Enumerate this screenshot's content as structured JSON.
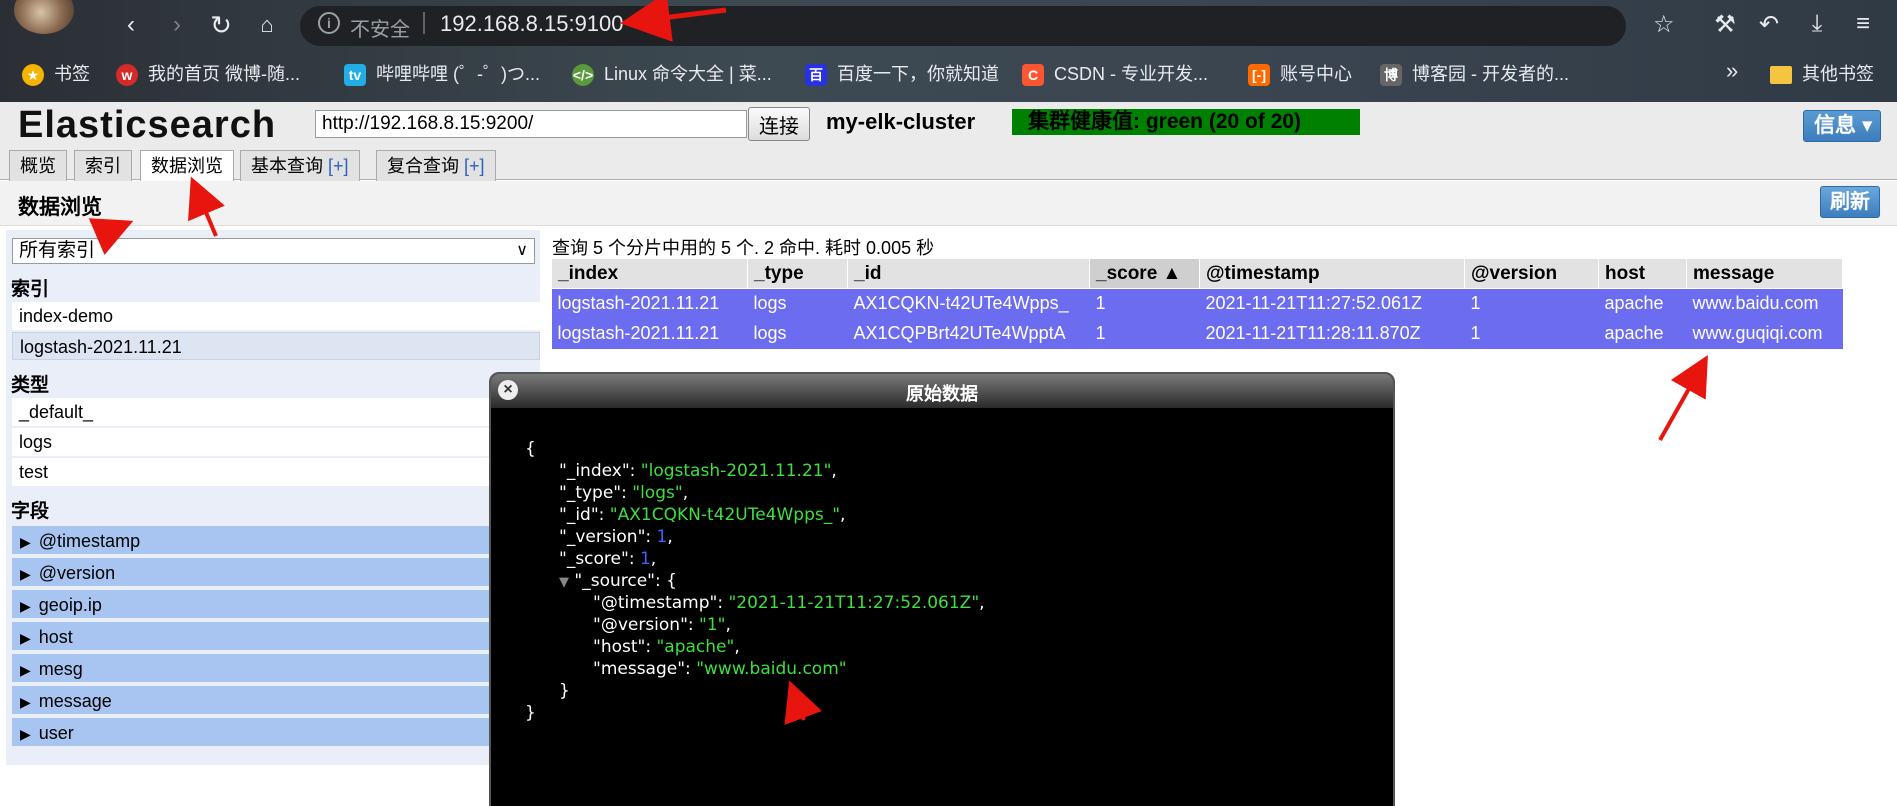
{
  "browser": {
    "address": {
      "insecure_label": "不安全",
      "url": "192.168.8.15:9100"
    },
    "bookmarks": [
      {
        "label": "书签",
        "icon": "star-icon",
        "color": "#f5b400"
      },
      {
        "label": "我的首页 微博-随...",
        "icon": "weibo-icon",
        "color": "#d52a2a"
      },
      {
        "label": "哔哩哔哩 (゜-゜)つ...",
        "icon": "bilibili-icon",
        "color": "#23ade5"
      },
      {
        "label": "Linux 命令大全 | 菜...",
        "icon": "code-icon",
        "color": "#5a9a3a"
      },
      {
        "label": "百度一下，你就知道",
        "icon": "baidu-icon",
        "color": "#2932e1"
      },
      {
        "label": "CSDN - 专业开发...",
        "icon": "csdn-icon",
        "color": "#fc5531"
      },
      {
        "label": "账号中心",
        "icon": "aliyun-icon",
        "color": "#ff6a00"
      },
      {
        "label": "博客园 - 开发者的...",
        "icon": "cnblogs-icon",
        "color": "#666666"
      }
    ],
    "bookmarks_more": "»",
    "other_bookmarks": "其他书签"
  },
  "es": {
    "logo": "Elasticsearch",
    "url_value": "http://192.168.8.15:9200/",
    "connect_label": "连接",
    "cluster_name": "my-elk-cluster",
    "health": "集群健康值: green (20 of 20)",
    "health_color": "#008000",
    "info_label": "信息 ▾",
    "tabs": [
      {
        "label": "概览",
        "plus": ""
      },
      {
        "label": "索引",
        "plus": ""
      },
      {
        "label": "数据浏览",
        "plus": ""
      },
      {
        "label": "基本查询 ",
        "plus": "[+]"
      },
      {
        "label": "复合查询 ",
        "plus": "[+]"
      }
    ],
    "active_tab": "数据浏览",
    "section_title": "数据浏览",
    "refresh_label": "刷新"
  },
  "sidebar": {
    "index_select": "所有索引",
    "index_heading": "索引",
    "indices": [
      "index-demo",
      "logstash-2021.11.21"
    ],
    "selected_index": "logstash-2021.11.21",
    "type_heading": "类型",
    "types": [
      "_default_",
      "logs",
      "test"
    ],
    "field_heading": "字段",
    "fields": [
      "@timestamp",
      "@version",
      "geoip.ip",
      "host",
      "mesg",
      "message",
      "user"
    ]
  },
  "results": {
    "summary": "查询 5 个分片中用的 5 个. 2 命中. 耗时 0.005 秒",
    "columns": [
      "_index",
      "_type",
      "_id",
      "_score ▲",
      "@timestamp",
      "@version",
      "host",
      "message"
    ],
    "rows": [
      [
        "logstash-2021.11.21",
        "logs",
        "AX1CQKN-t42UTe4Wpps_",
        "1",
        "2021-11-21T11:27:52.061Z",
        "1",
        "apache",
        "www.baidu.com"
      ],
      [
        "logstash-2021.11.21",
        "logs",
        "AX1CQPBrt42UTe4WpptA",
        "1",
        "2021-11-21T11:28:11.870Z",
        "1",
        "apache",
        "www.guqiqi.com"
      ]
    ],
    "row_color": "#6c6cf0"
  },
  "modal": {
    "title": "原始数据",
    "close_symbol": "×",
    "json_lines": {
      "open": "{",
      "index_key": "\"_index\"",
      "index_val": "\"logstash-2021.11.21\"",
      "type_key": "\"_type\"",
      "type_val": "\"logs\"",
      "id_key": "\"_id\"",
      "id_val": "\"AX1CQKN-t42UTe4Wpps_\"",
      "version_key": "\"_version\"",
      "version_val": "1",
      "score_key": "\"_score\"",
      "score_val": "1",
      "source_key": "\"_source\"",
      "ts_key": "\"@timestamp\"",
      "ts_val": "\"2021-11-21T11:27:52.061Z\"",
      "ver_key": "\"@version\"",
      "ver_val": "\"1\"",
      "host_key": "\"host\"",
      "host_val": "\"apache\"",
      "msg_key": "\"message\"",
      "msg_val": "\"www.baidu.com\"",
      "inner_close": "}",
      "close": "}"
    }
  }
}
